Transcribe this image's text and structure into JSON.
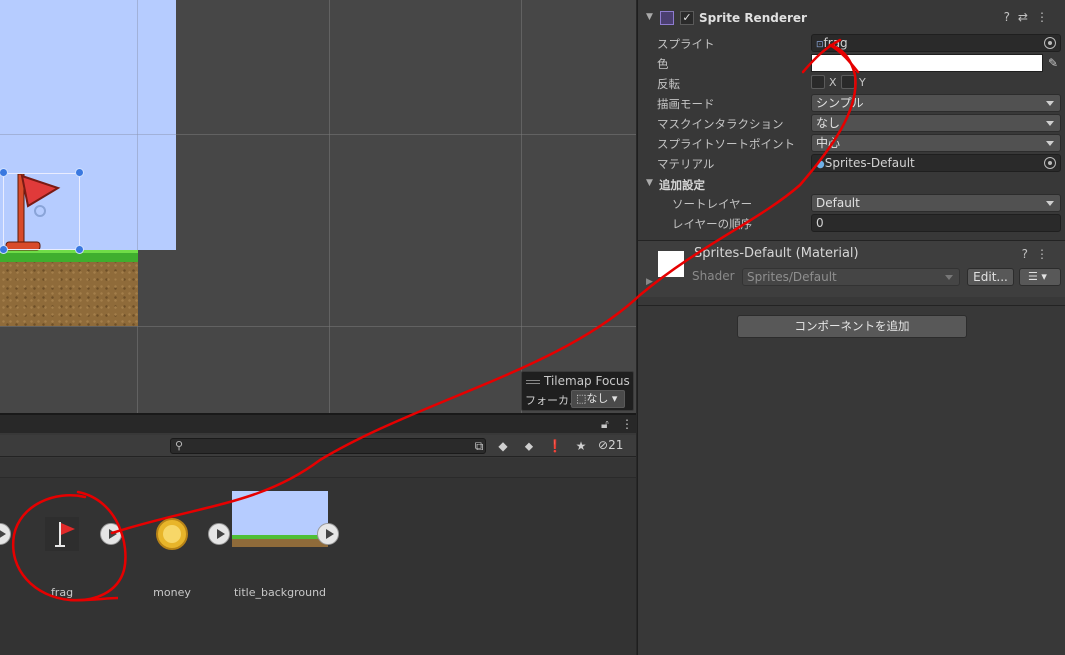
{
  "inspector": {
    "component": {
      "title": "Sprite Renderer",
      "enabled": "✓",
      "icons": "?⇄⋮"
    },
    "rows": [
      {
        "label": "スプライト",
        "value": "frag"
      },
      {
        "label": "色"
      },
      {
        "label": "反転",
        "x": "X",
        "y": "Y"
      },
      {
        "label": "描画モード",
        "value": "シンプル"
      },
      {
        "label": "マスクインタラクション",
        "value": "なし"
      },
      {
        "label": "スプライトソートポイント",
        "value": "中心"
      },
      {
        "label": "マテリアル",
        "value": "Sprites-Default"
      }
    ],
    "additional": {
      "title": "追加設定",
      "sorting_layer_label": "ソートレイヤー",
      "sorting_layer_value": "Default",
      "order_label": "レイヤーの順序",
      "order_value": "0"
    },
    "material": {
      "title": "Sprites-Default (Material)",
      "help_icons": "?⋮",
      "shader_label": "Shader",
      "shader_value": "Sprites/Default",
      "edit_button": "Edit...",
      "list_button": "☰ ▾"
    },
    "add_component_button": "コンポーネントを追加"
  },
  "scene": {
    "tilemap_focus_title": "Tilemap Focus",
    "focus_label": "フォーカス",
    "focus_value": "なし"
  },
  "project": {
    "hidden_count": "21",
    "assets": [
      {
        "name": "frag"
      },
      {
        "name": "money"
      },
      {
        "name": "title_background"
      }
    ]
  },
  "colors": {
    "annotation": "#e60000",
    "sky": "#b6ccff",
    "grass": "#3fae2e",
    "flag": "#e03a3a"
  }
}
